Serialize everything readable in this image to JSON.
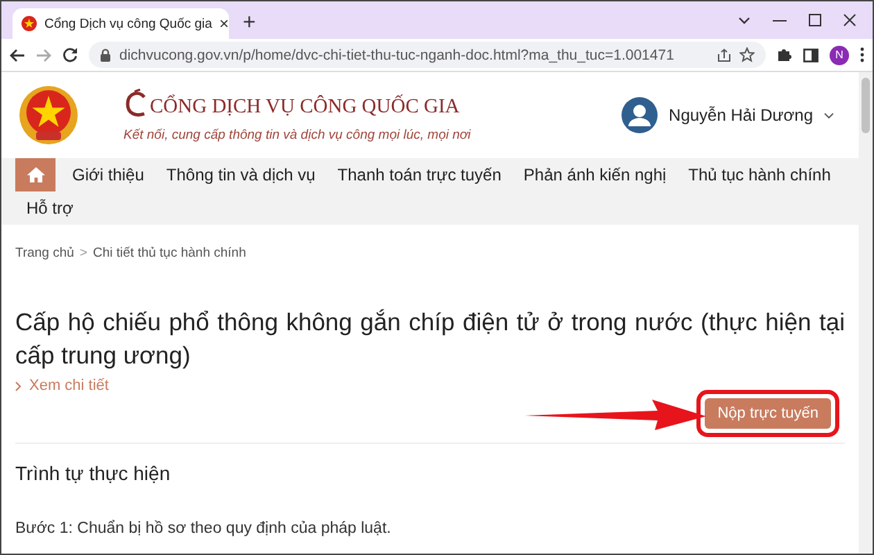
{
  "browser": {
    "tab": {
      "title": "Cổng Dịch vụ công Quốc gia",
      "close": "×"
    },
    "new_tab": "+",
    "address": "dichvucong.gov.vn/p/home/dvc-chi-tiet-thu-tuc-nganh-doc.html?ma_thu_tuc=1.001471",
    "profile_initial": "N"
  },
  "header": {
    "site_title": "CỔNG DỊCH VỤ CÔNG QUỐC GIA",
    "slogan": "Kết nối, cung cấp thông tin và dịch vụ công mọi lúc, mọi nơi",
    "user_name": "Nguyễn Hải Dương"
  },
  "nav": {
    "items": [
      {
        "label": "Giới thiệu"
      },
      {
        "label": "Thông tin và dịch vụ"
      },
      {
        "label": "Thanh toán trực tuyến"
      },
      {
        "label": "Phản ánh kiến nghị"
      },
      {
        "label": "Thủ tục hành chính"
      },
      {
        "label": "Hỗ trợ"
      }
    ]
  },
  "breadcrumb": {
    "items": [
      "Trang chủ",
      "Chi tiết thủ tục hành chính"
    ],
    "separator": ">"
  },
  "procedure": {
    "title": "Cấp hộ chiếu phổ thông không gắn chíp điện tử ở trong nước (thực hiện tại cấp trung ương)",
    "details_link": "Xem chi tiết",
    "submit_button": "Nộp trực tuyến"
  },
  "annotation": {
    "ring": true,
    "arrow": true
  },
  "sections": [
    {
      "heading": "Trình tự thực hiện",
      "paragraphs": [
        "Bước 1: Chuẩn bị hồ sơ theo quy định của pháp luật."
      ]
    }
  ]
}
